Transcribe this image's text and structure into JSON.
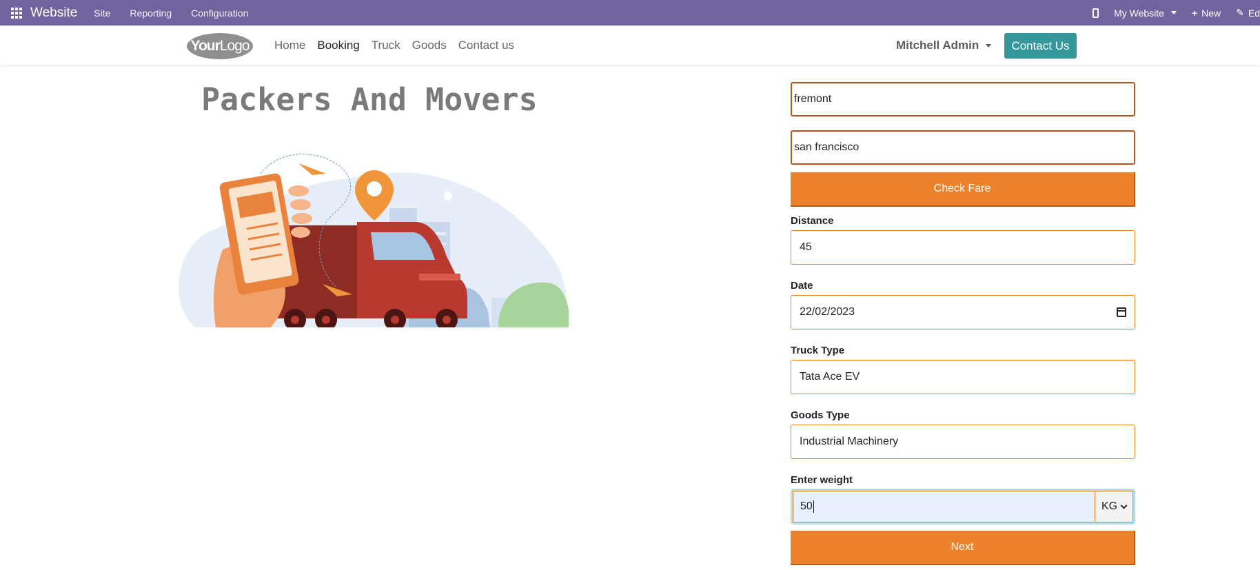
{
  "adminbar": {
    "brand": "Website",
    "menus": [
      "Site",
      "Reporting",
      "Configuration"
    ],
    "my_website": "My Website",
    "new_label": "New",
    "edit_label": "Ed"
  },
  "navbar": {
    "logo_bold": "Your",
    "logo_light": "Logo",
    "links": [
      "Home",
      "Booking",
      "Truck",
      "Goods",
      "Contact us"
    ],
    "user": "Mitchell Admin",
    "contact_button": "Contact Us"
  },
  "hero": {
    "title": "Packers And Movers"
  },
  "form": {
    "from": "fremont",
    "to": "san francisco",
    "check_fare": "Check Fare",
    "distance_label": "Distance",
    "distance": "45",
    "date_label": "Date",
    "date": "22/02/2023",
    "truck_type_label": "Truck Type",
    "truck_type": "Tata Ace EV",
    "goods_type_label": "Goods Type",
    "goods_type": "Industrial Machinery",
    "weight_label": "Enter weight",
    "weight": "50",
    "unit": "KG",
    "next": "Next"
  },
  "colors": {
    "adminbar": "#71639e",
    "accent": "#ec832c",
    "contact_button": "#35979c"
  }
}
